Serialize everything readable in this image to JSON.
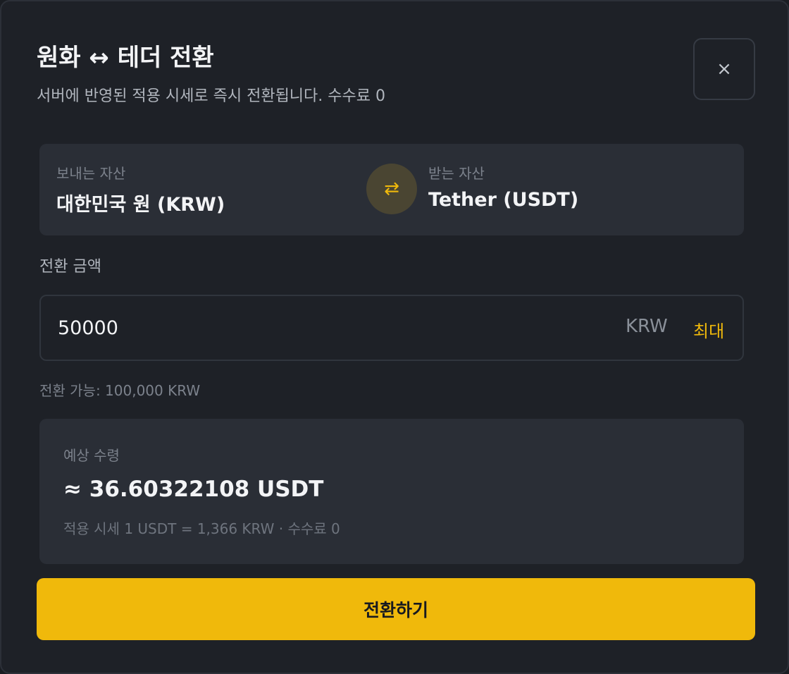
{
  "header": {
    "title": "원화 ↔ 테더 전환",
    "subtitle": "서버에 반영된 적용 시세로 즉시 전환됩니다. 수수료 0",
    "close_label": "×"
  },
  "assets": {
    "from_label": "보내는 자산",
    "from_value": "대한민국 원 (KRW)",
    "to_label": "받는 자산",
    "to_value": "Tether (USDT)",
    "swap_icon": "⇄"
  },
  "amount": {
    "label": "전환 금액",
    "value": "50000",
    "currency": "KRW",
    "max_label": "최대",
    "available": "전환 가능: 100,000 KRW"
  },
  "estimate": {
    "label": "예상 수령",
    "value": "≈ 36.60322108 USDT",
    "rate": "적용 시세 1 USDT = 1,366 KRW · 수수료 0"
  },
  "actions": {
    "convert_label": "전환하기"
  },
  "colors": {
    "accent": "#f0b90b",
    "background": "#1e2127",
    "panel": "#2a2e36"
  }
}
